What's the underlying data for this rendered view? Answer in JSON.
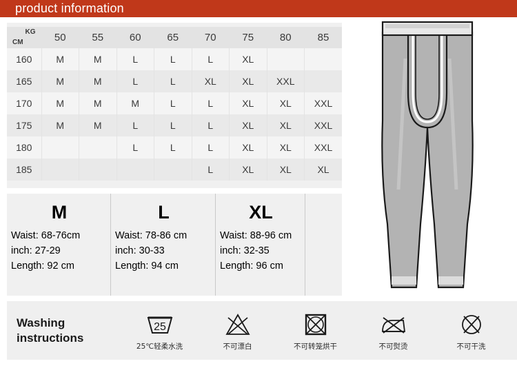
{
  "header": {
    "title": "product information",
    "bar_color": "#c0381a"
  },
  "size_table": {
    "corner": {
      "kg_label": "KG",
      "cm_label": "CM"
    },
    "weights": [
      "50",
      "55",
      "60",
      "65",
      "70",
      "75",
      "80",
      "85"
    ],
    "rows": [
      {
        "height": "160",
        "sizes": [
          "M",
          "M",
          "L",
          "L",
          "L",
          "XL",
          "",
          ""
        ]
      },
      {
        "height": "165",
        "sizes": [
          "M",
          "M",
          "L",
          "L",
          "XL",
          "XL",
          "XXL",
          ""
        ]
      },
      {
        "height": "170",
        "sizes": [
          "M",
          "M",
          "M",
          "L",
          "L",
          "XL",
          "XL",
          "XXL"
        ]
      },
      {
        "height": "175",
        "sizes": [
          "M",
          "M",
          "L",
          "L",
          "L",
          "XL",
          "XL",
          "XXL"
        ]
      },
      {
        "height": "180",
        "sizes": [
          "",
          "",
          "L",
          "L",
          "L",
          "XL",
          "XL",
          "XXL"
        ]
      },
      {
        "height": "185",
        "sizes": [
          "",
          "",
          "",
          "",
          "L",
          "XL",
          "XL",
          "XL"
        ]
      }
    ]
  },
  "measurements": [
    {
      "size": "M",
      "waist": "Waist:  68-76cm",
      "inch": "inch: 27-29",
      "length": "Length:  92 cm"
    },
    {
      "size": "L",
      "waist": "Waist: 78-86 cm",
      "inch": "inch:  30-33",
      "length": "Length: 94 cm"
    },
    {
      "size": "XL",
      "waist": "Waist: 88-96 cm",
      "inch": "inch: 32-35",
      "length": "Length: 96 cm"
    }
  ],
  "washing": {
    "title_line1": "Washing",
    "title_line2": "instructions",
    "care_items": [
      {
        "icon": "wash-tub-25-icon",
        "temp": "25",
        "label": "25℃轻柔水洗"
      },
      {
        "icon": "no-bleach-icon",
        "label": "不可漂白"
      },
      {
        "icon": "no-tumble-dry-icon",
        "label": "不可转笼烘干"
      },
      {
        "icon": "no-iron-icon",
        "label": "不可熨烫"
      },
      {
        "icon": "no-dry-clean-icon",
        "label": "不可干洗"
      }
    ]
  },
  "illustration": {
    "name": "thermal-long-johns-pants-technical-drawing",
    "fabric_color": "#b3b3b3",
    "outline_color": "#1a1a1a",
    "waistband_color": "#e8e8e8"
  }
}
